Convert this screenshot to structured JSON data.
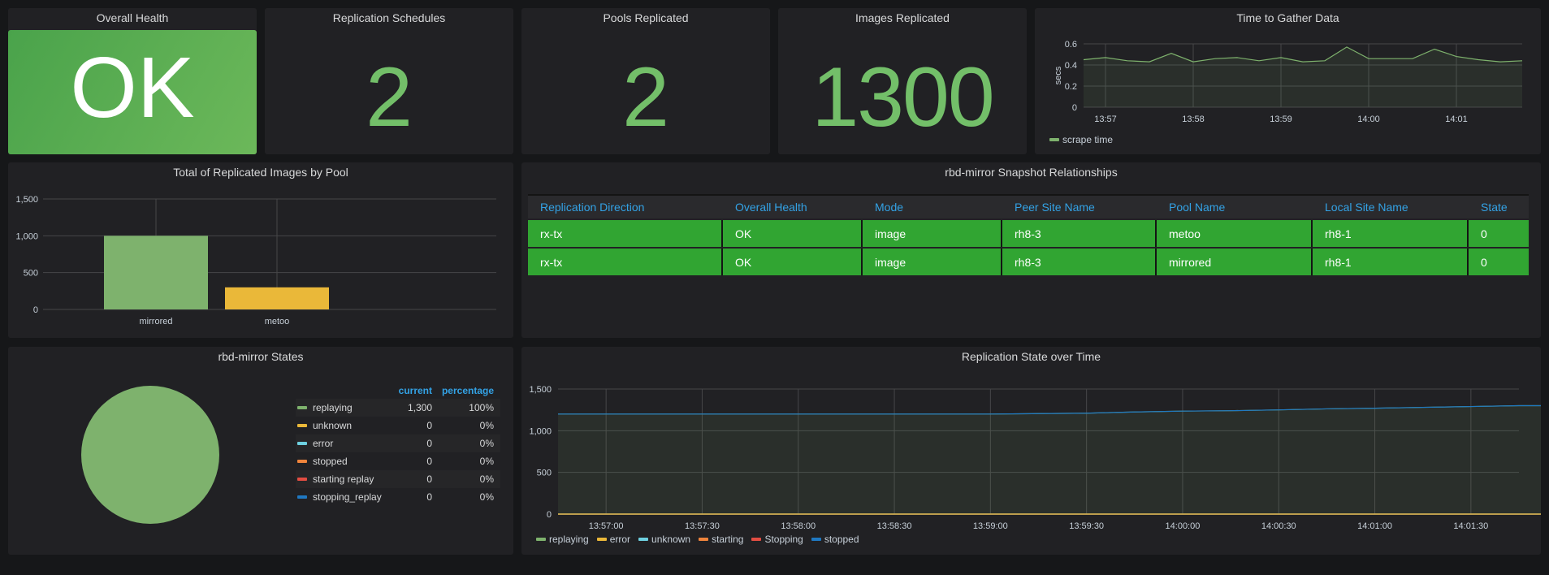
{
  "colors": {
    "green": "#73bf69",
    "bar_green": "#7eb26d",
    "yellow": "#eab839",
    "light_blue": "#6ed0e0",
    "orange": "#ef843c",
    "red": "#e24d42",
    "blue": "#1f78c1",
    "header_blue": "#33a2e5",
    "row_green": "#31a532"
  },
  "stats": {
    "overall_health": {
      "title": "Overall Health",
      "value": "OK"
    },
    "replication_schedules": {
      "title": "Replication Schedules",
      "value": "2"
    },
    "pools_replicated": {
      "title": "Pools Replicated",
      "value": "2"
    },
    "images_replicated": {
      "title": "Images Replicated",
      "value": "1300"
    }
  },
  "relationships": {
    "title": "rbd-mirror Snapshot Relationships",
    "columns": [
      "Replication Direction",
      "Overall Health",
      "Mode",
      "Peer Site Name",
      "Pool Name",
      "Local Site Name",
      "State"
    ],
    "rows": [
      [
        "rx-tx",
        "OK",
        "image",
        "rh8-3",
        "metoo",
        "rh8-1",
        "0"
      ],
      [
        "rx-tx",
        "OK",
        "image",
        "rh8-3",
        "mirrored",
        "rh8-1",
        "0"
      ]
    ]
  },
  "pie": {
    "title": "rbd-mirror States",
    "header_current": "current",
    "header_percentage": "percentage",
    "rows": [
      {
        "name": "replaying",
        "current": "1,300",
        "percentage": "100%",
        "color": "#7eb26d"
      },
      {
        "name": "unknown",
        "current": "0",
        "percentage": "0%",
        "color": "#eab839"
      },
      {
        "name": "error",
        "current": "0",
        "percentage": "0%",
        "color": "#6ed0e0"
      },
      {
        "name": "stopped",
        "current": "0",
        "percentage": "0%",
        "color": "#ef843c"
      },
      {
        "name": "starting replay",
        "current": "0",
        "percentage": "0%",
        "color": "#e24d42"
      },
      {
        "name": "stopping_replay",
        "current": "0",
        "percentage": "0%",
        "color": "#1f78c1"
      }
    ]
  },
  "chart_data": [
    {
      "id": "time_to_gather",
      "type": "area",
      "title": "Time to Gather Data",
      "ylabel": "secs",
      "xlabel": "",
      "ylim": [
        0,
        0.6
      ],
      "yticks": [
        "0",
        "0.2",
        "0.4",
        "0.6"
      ],
      "xticks": [
        "13:57",
        "13:58",
        "13:59",
        "14:00",
        "14:01"
      ],
      "grid": true,
      "legend_position": "bottom-left",
      "x_start": "13:56:45",
      "x_end": "14:01:45",
      "interval_seconds": 15,
      "series": [
        {
          "name": "scrape time",
          "color": "#7eb26d",
          "values": [
            0.45,
            0.47,
            0.44,
            0.43,
            0.51,
            0.43,
            0.46,
            0.47,
            0.44,
            0.47,
            0.43,
            0.44,
            0.57,
            0.46,
            0.46,
            0.46,
            0.55,
            0.48,
            0.45,
            0.43,
            0.44
          ]
        }
      ]
    },
    {
      "id": "replicated_by_pool",
      "type": "bar",
      "title": "Total of Replicated Images by Pool",
      "categories": [
        "mirrored",
        "metoo"
      ],
      "values": [
        1000,
        300
      ],
      "colors": [
        "#7eb26d",
        "#eab839"
      ],
      "yticks": [
        "0",
        "500",
        "1,000",
        "1,500"
      ],
      "ylim": [
        0,
        1500
      ],
      "xlabel": "",
      "ylabel": "",
      "grid": true
    },
    {
      "id": "rbd_mirror_states_pie",
      "type": "pie",
      "title": "rbd-mirror States",
      "labels": [
        "replaying",
        "unknown",
        "error",
        "stopped",
        "starting replay",
        "stopping_replay"
      ],
      "values": [
        1300,
        0,
        0,
        0,
        0,
        0
      ],
      "colors": [
        "#7eb26d",
        "#eab839",
        "#6ed0e0",
        "#ef843c",
        "#e24d42",
        "#1f78c1"
      ]
    },
    {
      "id": "replication_state_over_time",
      "type": "area",
      "title": "Replication State over Time",
      "ylim": [
        0,
        1500
      ],
      "yticks": [
        "0",
        "500",
        "1,000",
        "1,500"
      ],
      "xticks": [
        "13:57:00",
        "13:57:30",
        "13:58:00",
        "13:58:30",
        "13:59:00",
        "13:59:30",
        "14:00:00",
        "14:00:30",
        "14:01:00",
        "14:01:30"
      ],
      "grid": true,
      "legend_position": "bottom-left",
      "x_start": "13:56:45",
      "x_end": "14:01:45",
      "interval_seconds": 15,
      "series": [
        {
          "name": "replaying",
          "color": "#7eb26d",
          "values": [
            1200,
            1200,
            1200,
            1200,
            1200,
            1200,
            1200,
            1200,
            1200,
            1200,
            1205,
            1210,
            1225,
            1235,
            1240,
            1250,
            1262,
            1270,
            1280,
            1290,
            1300,
            1300,
            1300
          ]
        },
        {
          "name": "error",
          "color": "#eab839",
          "values": [
            0,
            0,
            0,
            0,
            0,
            0,
            0,
            0,
            0,
            0,
            0,
            0,
            0,
            0,
            0,
            0,
            0,
            0,
            0,
            0,
            0,
            0,
            0
          ]
        },
        {
          "name": "unknown",
          "color": "#6ed0e0",
          "values": [
            0,
            0,
            0,
            0,
            0,
            0,
            0,
            0,
            0,
            0,
            0,
            0,
            0,
            0,
            0,
            0,
            0,
            0,
            0,
            0,
            0,
            0,
            0
          ]
        },
        {
          "name": "starting",
          "color": "#ef843c",
          "values": [
            0,
            0,
            0,
            0,
            0,
            0,
            0,
            0,
            0,
            0,
            0,
            0,
            0,
            0,
            0,
            0,
            0,
            0,
            0,
            0,
            0,
            0,
            0
          ]
        },
        {
          "name": "Stopping",
          "color": "#e24d42",
          "values": [
            0,
            0,
            0,
            0,
            0,
            0,
            0,
            0,
            0,
            0,
            0,
            0,
            0,
            0,
            0,
            0,
            0,
            0,
            0,
            0,
            0,
            0,
            0
          ]
        },
        {
          "name": "stopped",
          "color": "#1f78c1",
          "values": [
            0,
            0,
            0,
            0,
            0,
            0,
            0,
            0,
            0,
            0,
            0,
            0,
            0,
            0,
            0,
            0,
            0,
            0,
            0,
            0,
            0,
            0,
            0
          ]
        }
      ]
    }
  ]
}
